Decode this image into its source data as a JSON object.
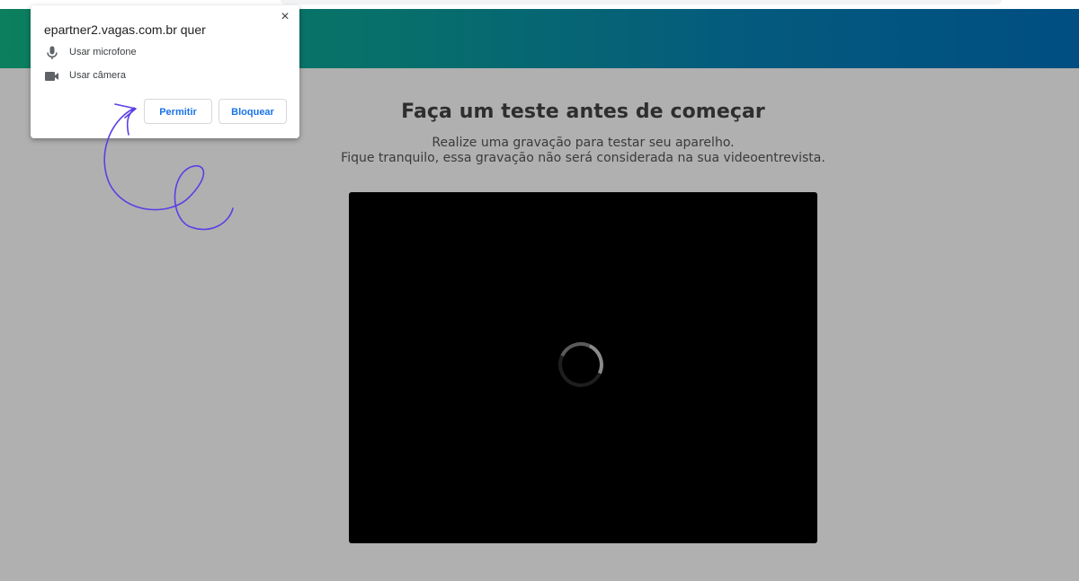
{
  "popup": {
    "title": "epartner2.vagas.com.br quer",
    "close_label": "×",
    "permissions": [
      {
        "label": "Usar microfone",
        "icon": "microphone-icon"
      },
      {
        "label": "Usar câmera",
        "icon": "camera-icon"
      }
    ],
    "allow_label": "Permitir",
    "block_label": "Bloquear"
  },
  "page": {
    "title": "Faça um teste antes de começar",
    "subtitle_line1": "Realize uma gravação para testar seu aparelho.",
    "subtitle_line2": "Fique tranquilo, essa gravação não será considerada na sua videoentrevista."
  },
  "colors": {
    "header_gradient_start": "#0b7f5e",
    "header_gradient_end": "#004e82",
    "accent_blue": "#1a73e8",
    "annotation_purple": "#5b3fe6",
    "video_background": "#000000"
  }
}
